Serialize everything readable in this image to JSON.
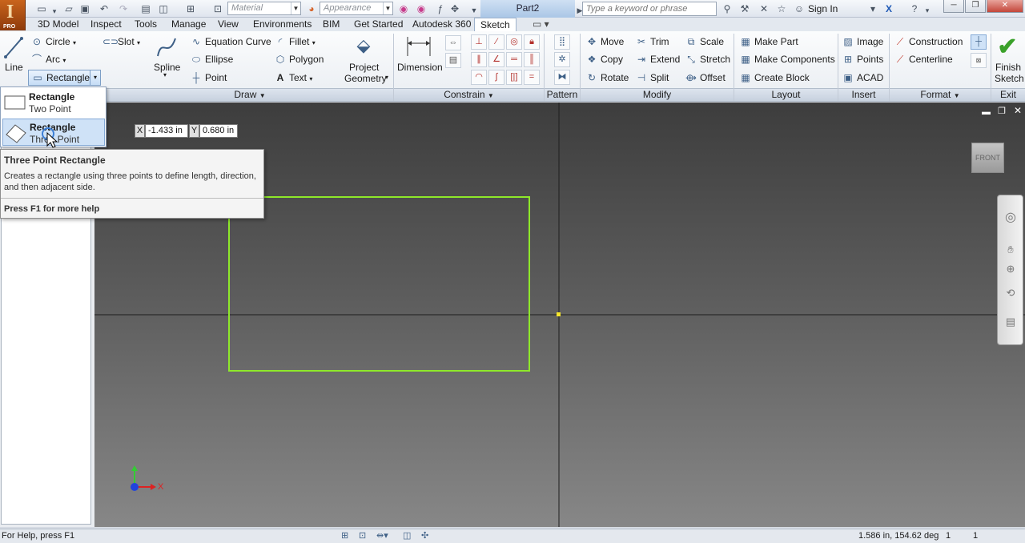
{
  "app": {
    "logo_letter": "I",
    "logo_badge": "PRO",
    "document_title": "Part2"
  },
  "quick_access": {
    "material_placeholder": "Material",
    "appearance_placeholder": "Appearance",
    "search_placeholder": "Type a keyword or phrase",
    "sign_in": "Sign In"
  },
  "menu_tabs": [
    "3D Model",
    "Inspect",
    "Tools",
    "Manage",
    "View",
    "Environments",
    "BIM",
    "Get Started",
    "Autodesk 360",
    "Sketch"
  ],
  "active_tab": "Sketch",
  "ribbon": {
    "draw": {
      "line": "Line",
      "circle": "Circle",
      "arc": "Arc",
      "rectangle": "Rectangle",
      "slot": "Slot",
      "spline": "Spline",
      "equation_curve": "Equation Curve",
      "ellipse": "Ellipse",
      "point": "Point",
      "fillet": "Fillet",
      "polygon": "Polygon",
      "text": "Text",
      "project_geometry_1": "Project",
      "project_geometry_2": "Geometry"
    },
    "dimension": "Dimension",
    "modify": {
      "move": "Move",
      "trim": "Trim",
      "scale": "Scale",
      "copy": "Copy",
      "extend": "Extend",
      "stretch": "Stretch",
      "rotate": "Rotate",
      "split": "Split",
      "offset": "Offset"
    },
    "layout": {
      "make_part": "Make Part",
      "make_components": "Make Components",
      "create_block": "Create Block"
    },
    "insert": {
      "image": "Image",
      "points": "Points",
      "acad": "ACAD"
    },
    "format": {
      "construction": "Construction",
      "centerline": "Centerline"
    },
    "exit": {
      "finish_1": "Finish",
      "finish_2": "Sketch"
    },
    "panels": {
      "draw": "Draw",
      "constrain": "Constrain",
      "pattern": "Pattern",
      "modify": "Modify",
      "layout": "Layout",
      "insert": "Insert",
      "format": "Format",
      "exit": "Exit"
    }
  },
  "rect_dropdown": {
    "item1_title": "Rectangle",
    "item1_sub": "Two Point",
    "item2_title": "Rectangle",
    "item2_sub": "Three Point"
  },
  "tooltip": {
    "title": "Three Point Rectangle",
    "description": "Creates a rectangle using three points to define length, direction, and then adjacent side.",
    "help": "Press F1 for more help"
  },
  "coordinates": {
    "x_label": "X",
    "x_value": "-1.433 in",
    "y_label": "Y",
    "y_value": "0.680 in"
  },
  "viewcube": "FRONT",
  "triad": {
    "x": "X"
  },
  "status": {
    "help": "For Help, press F1",
    "readout": "1.586 in, 154.62 deg",
    "count1": "1",
    "count2": "1"
  },
  "colors": {
    "sketch_line": "#8ee82a",
    "ribbon_accent": "#3d5f86",
    "canvas_top": "#3d3d3d",
    "canvas_bottom": "#878787"
  }
}
